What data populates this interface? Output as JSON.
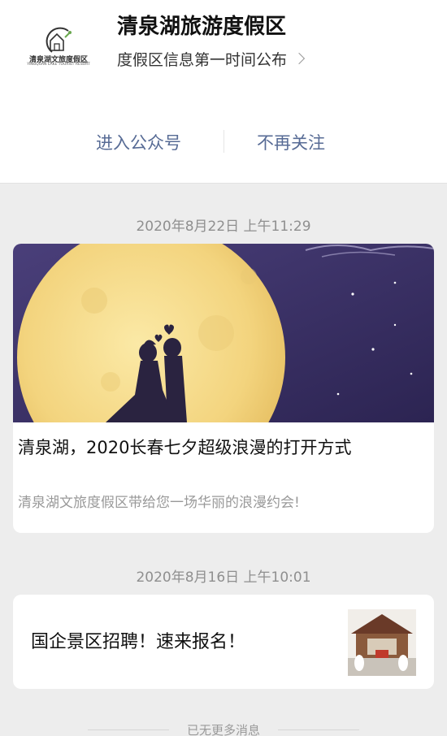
{
  "account": {
    "name": "清泉湖旅游度假区",
    "description": "度假区信息第一时间公布",
    "logo_text": "清泉湖文旅度假区",
    "logo_subtext": "YINGQUAN LAKE TOURIST RESORT",
    "logo_icon": "house-crescent-logo"
  },
  "actions": {
    "enter_label": "进入公众号",
    "unfollow_label": "不再关注"
  },
  "messages": [
    {
      "timestamp": "2020年8月22日 上午11:29",
      "title": "清泉湖，2020长春七夕超级浪漫的打开方式",
      "summary": "清泉湖文旅度假区带给您一场华丽的浪漫约会!",
      "cover": "full-moon-couple-silhouette"
    },
    {
      "timestamp": "2020年8月16日 上午10:01",
      "title": "国企景区招聘！速来报名！",
      "thumbnail": "pavilion-performers-photo"
    }
  ],
  "footer": {
    "end_text": "已无更多消息"
  },
  "colors": {
    "link": "#576b95",
    "background": "#ededed",
    "card": "#ffffff",
    "timestamp": "#8f8f8f"
  }
}
